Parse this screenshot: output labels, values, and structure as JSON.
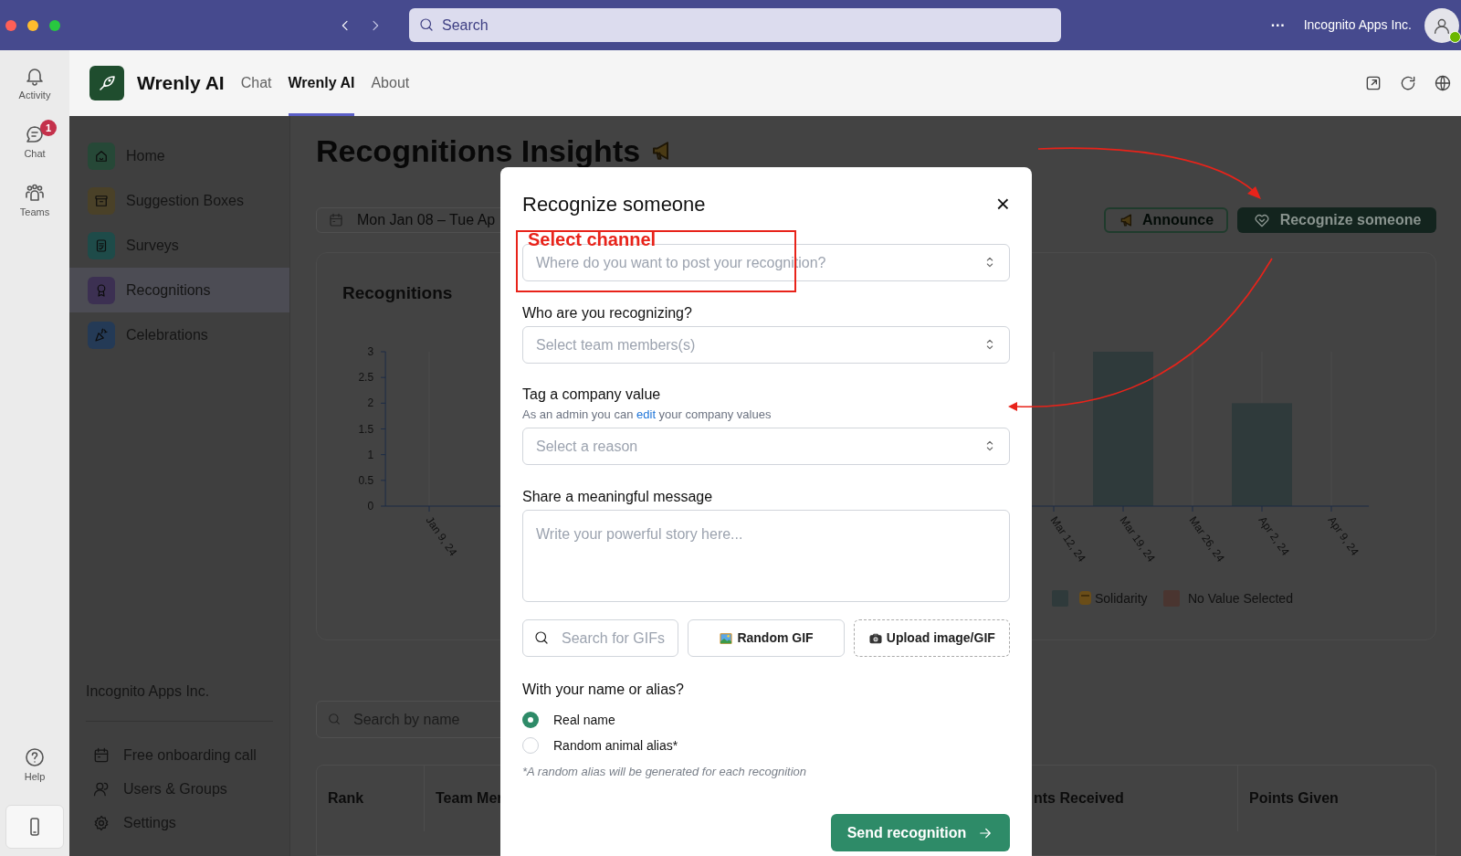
{
  "title_bar": {
    "search_placeholder": "Search",
    "more": "···",
    "account": "Incognito Apps Inc."
  },
  "rail": {
    "items": [
      {
        "label": "Activity"
      },
      {
        "label": "Chat",
        "badge": "1"
      },
      {
        "label": "Teams"
      }
    ],
    "bottom_items": [
      {
        "label": "Help"
      }
    ]
  },
  "app": {
    "name": "Wrenly AI",
    "tabs": [
      {
        "label": "Chat",
        "selected": false
      },
      {
        "label": "Wrenly AI",
        "selected": true
      },
      {
        "label": "About",
        "selected": false
      }
    ]
  },
  "sidebar": {
    "items": [
      {
        "label": "Home",
        "color": "#264837",
        "selected": false
      },
      {
        "label": "Suggestion Boxes",
        "color": "#4a4128",
        "selected": false
      },
      {
        "label": "Surveys",
        "color": "#1e4b49",
        "selected": false
      },
      {
        "label": "Recognitions",
        "color": "#3c3052",
        "selected": true
      },
      {
        "label": "Celebrations",
        "color": "#243a56",
        "selected": false
      }
    ],
    "org": "Incognito Apps Inc.",
    "footer_links": [
      {
        "label": "Free onboarding call"
      },
      {
        "label": "Users & Groups"
      },
      {
        "label": "Settings"
      }
    ]
  },
  "page": {
    "title": "Recognitions Insights",
    "date_range": "Mon Jan 08 – Tue Ap",
    "buttons": [
      {
        "label": "Announce",
        "kind": "outline"
      },
      {
        "label": "Recognize someone",
        "kind": "primary"
      }
    ],
    "chart": {
      "chart_data": {
        "type": "bar",
        "title": "Recognitions",
        "categories": [
          "Jan 9, 24",
          null,
          null,
          null,
          null,
          null,
          null,
          null,
          null,
          "Mar 12, 24",
          "Mar 19, 24",
          "Mar 26, 24",
          "Apr 2, 24",
          "Apr 9, 24"
        ],
        "ylim": [
          0,
          3
        ],
        "yticks": [
          0,
          0.5,
          1,
          1.5,
          2,
          2.5,
          3
        ],
        "series": [
          {
            "name": "Solidarity",
            "color": "#2f3a3b",
            "values": [
              0,
              null,
              null,
              null,
              null,
              null,
              null,
              null,
              null,
              0,
              3,
              0,
              2,
              0
            ]
          },
          {
            "name": "No Value Selected",
            "color": "#4a3530",
            "values": [
              0,
              null,
              null,
              null,
              null,
              null,
              null,
              null,
              null,
              0,
              0,
              0,
              0,
              0
            ]
          }
        ]
      }
    },
    "search_placeholder": "Search by name",
    "table": {
      "columns": [
        "Rank",
        "Team Mer",
        "",
        "nts Received",
        "Points Given"
      ]
    }
  },
  "modal": {
    "title": "Recognize someone",
    "close": "×",
    "channel": {
      "placeholder": "Where do you want to post your recognition?"
    },
    "recipients": {
      "label": "Who are you recognizing?",
      "placeholder": "Select team members(s)"
    },
    "value": {
      "label": "Tag a company value",
      "help_before": "As an admin you can ",
      "help_link": "edit",
      "help_after": " your company values",
      "placeholder": "Select a reason"
    },
    "message": {
      "label": "Share a meaningful message",
      "placeholder": "Write your powerful story here..."
    },
    "gif_search": {
      "placeholder": "Search for GIFs"
    },
    "random_gif": "Random GIF",
    "upload": "Upload image/GIF",
    "identity": {
      "label": "With your name or alias?",
      "options": [
        {
          "label": "Real name",
          "selected": true
        },
        {
          "label": "Random animal alias*",
          "selected": false
        }
      ],
      "footnote": "*A random alias will be generated for each recognition"
    },
    "submit": "Send recognition"
  },
  "annotation": {
    "label": "Select channel"
  }
}
